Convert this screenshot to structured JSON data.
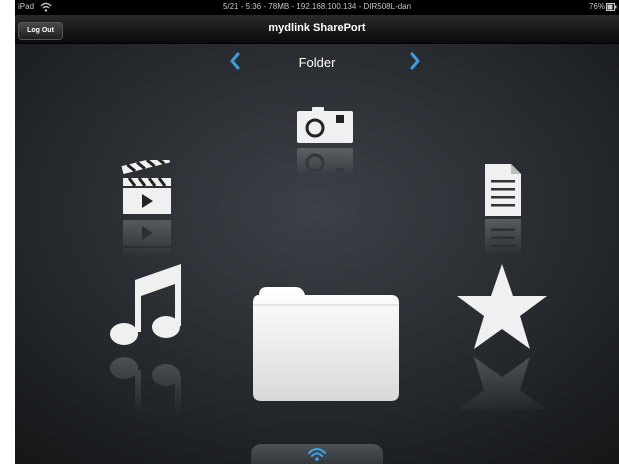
{
  "status_bar": {
    "device": "iPad",
    "center_info": "5/21 - 5:36 - 78MB - 192.168.100.134 - DIR508L-dan",
    "battery": "76%"
  },
  "nav_bar": {
    "logout_label": "Log Out",
    "title": "mydlink SharePort"
  },
  "carousel": {
    "current_category": "Folder",
    "items": [
      {
        "name": "Photos",
        "icon": "camera-icon"
      },
      {
        "name": "Videos",
        "icon": "clapperboard-icon"
      },
      {
        "name": "Documents",
        "icon": "document-icon"
      },
      {
        "name": "Music",
        "icon": "music-note-icon"
      },
      {
        "name": "Folder",
        "icon": "folder-icon"
      },
      {
        "name": "Favorites",
        "icon": "star-icon"
      }
    ]
  },
  "colors": {
    "accent": "#3a9fe0",
    "icon_fill": "#f0f0f0",
    "background": "#2e3237"
  }
}
